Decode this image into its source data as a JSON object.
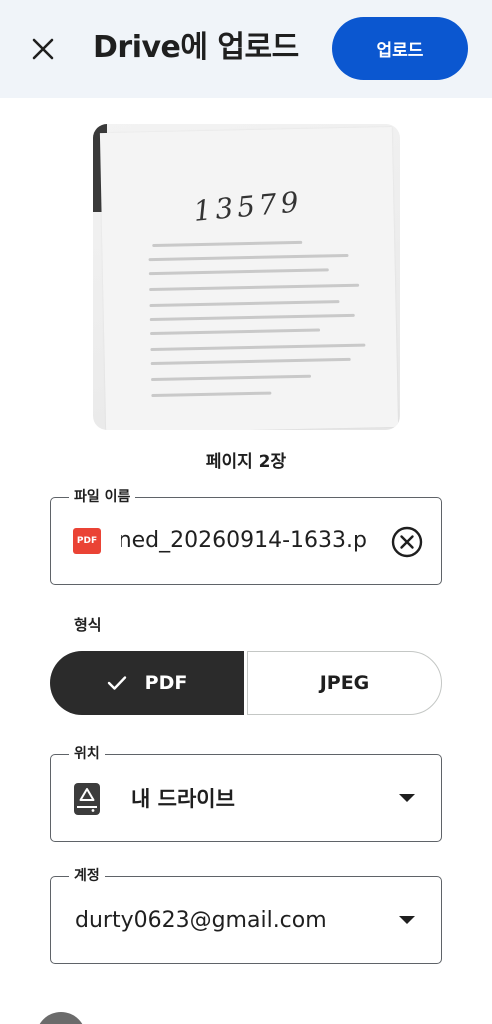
{
  "header": {
    "title": "Drive에 업로드",
    "upload_label": "업로드",
    "close_icon": "close-icon"
  },
  "preview": {
    "handwriting": "13579",
    "page_count": "페이지 2장"
  },
  "file_name": {
    "label": "파일 이름",
    "value": "ned_20260914-1633.p",
    "file_type_badge": "PDF"
  },
  "format": {
    "label": "형식",
    "options": [
      "PDF",
      "JPEG"
    ],
    "selected": "PDF"
  },
  "location": {
    "label": "위치",
    "value": "내 드라이브"
  },
  "account": {
    "label": "계정",
    "value": "durty0623@gmail.com"
  },
  "colors": {
    "accent": "#0b57d0",
    "header_bg": "#f0f4f9",
    "selected_segment": "#2b2b2b",
    "pdf_red": "#ea4335"
  }
}
